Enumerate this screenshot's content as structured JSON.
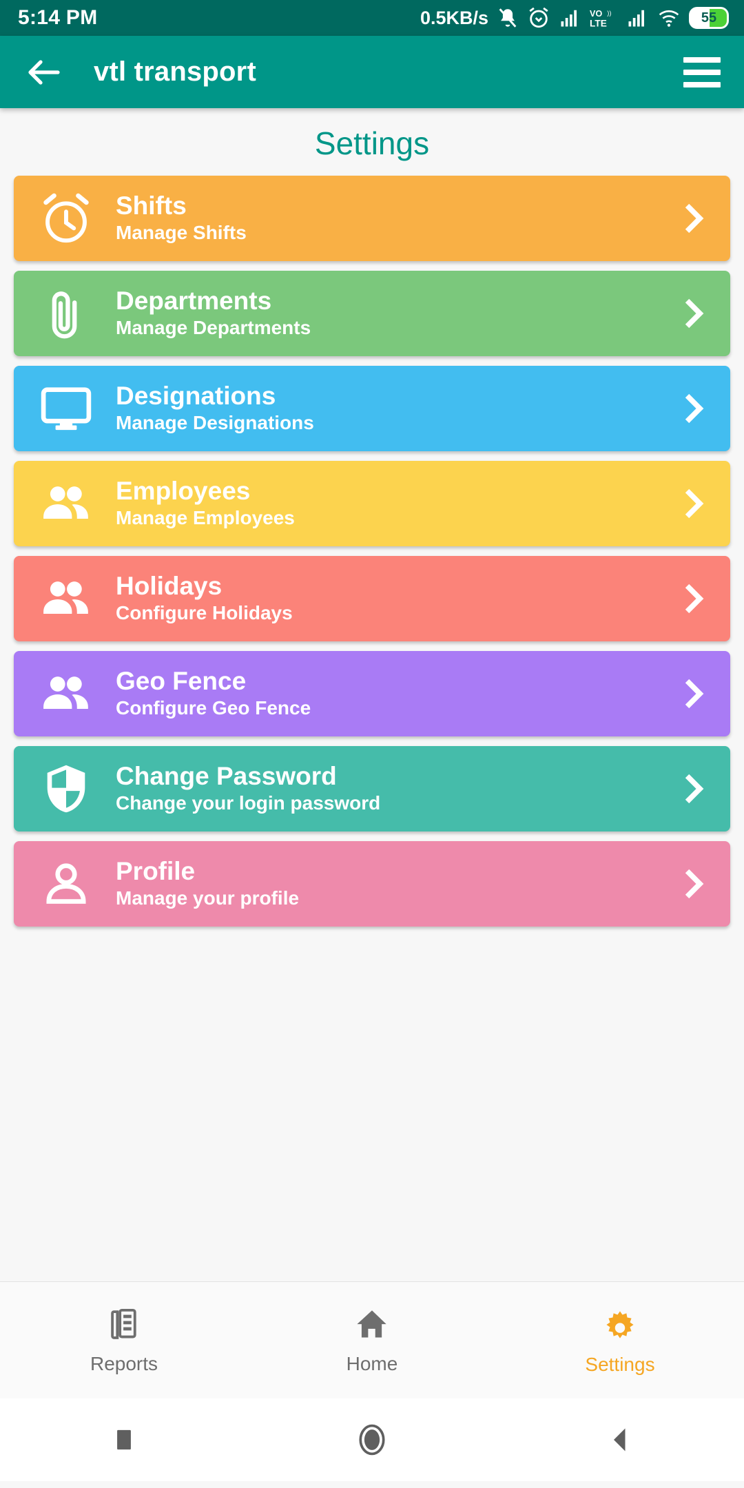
{
  "status_bar": {
    "time": "5:14 PM",
    "net_speed": "0.5KB/s",
    "battery_percent": "55",
    "icons": [
      "mute-icon",
      "alarm-icon",
      "signal-icon",
      "volte-icon",
      "signal-icon",
      "wifi-icon",
      "battery-icon"
    ]
  },
  "app_bar": {
    "back_label": "back-arrow",
    "title": "vtl transport",
    "menu_label": "menu"
  },
  "page": {
    "title": "Settings"
  },
  "cards": [
    {
      "title": "Shifts",
      "subtitle": "Manage Shifts",
      "color": "#f9b045",
      "icon": "alarm-clock-icon"
    },
    {
      "title": "Departments",
      "subtitle": "Manage Departments",
      "color": "#7bc87c",
      "icon": "paperclip-icon"
    },
    {
      "title": "Designations",
      "subtitle": "Manage Designations",
      "color": "#42bdf0",
      "icon": "monitor-icon"
    },
    {
      "title": "Employees",
      "subtitle": "Manage Employees",
      "color": "#fcd34e",
      "icon": "people-icon"
    },
    {
      "title": "Holidays",
      "subtitle": "Configure Holidays",
      "color": "#fb8379",
      "icon": "people-icon"
    },
    {
      "title": "Geo Fence",
      "subtitle": "Configure Geo Fence",
      "color": "#a97bf5",
      "icon": "people-icon"
    },
    {
      "title": "Change Password",
      "subtitle": "Change your login password",
      "color": "#45bcaa",
      "icon": "shield-icon"
    },
    {
      "title": "Profile",
      "subtitle": "Manage your profile",
      "color": "#ee8aab",
      "icon": "person-outline-icon"
    }
  ],
  "bottom_nav": {
    "active_color": "#f5a623",
    "inactive_color": "#6e6e6e",
    "items": [
      {
        "label": "Reports",
        "icon": "reports-icon",
        "active": false
      },
      {
        "label": "Home",
        "icon": "home-icon",
        "active": false
      },
      {
        "label": "Settings",
        "icon": "gear-icon",
        "active": true
      }
    ]
  },
  "system_nav": {
    "buttons": [
      "recents-square-icon",
      "home-circle-icon",
      "back-triangle-icon"
    ]
  }
}
